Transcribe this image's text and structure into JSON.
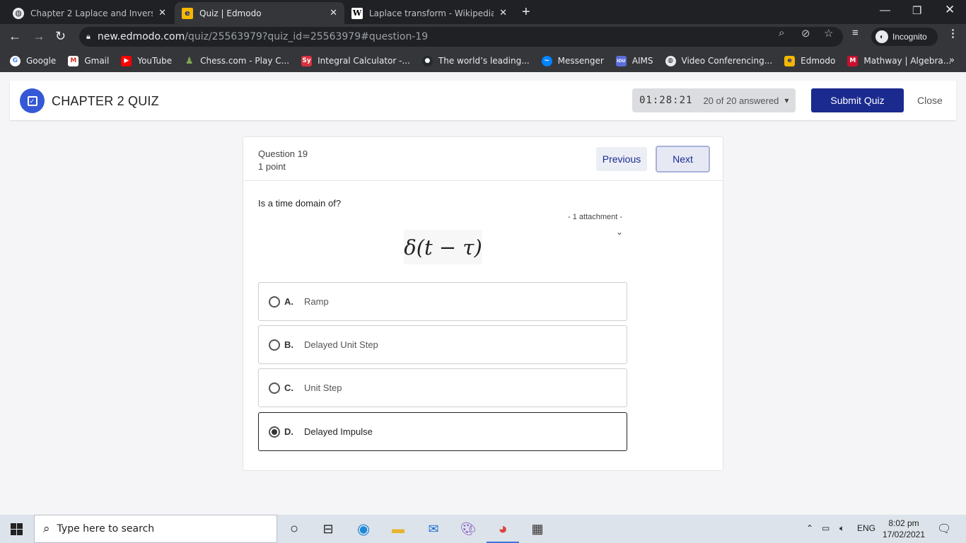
{
  "browser": {
    "tabs": [
      {
        "title": "Chapter 2 Laplace and Inverse Lap",
        "favicon": "chrome-globe-icon",
        "active": false
      },
      {
        "title": "Quiz | Edmodo",
        "favicon": "edmodo-icon",
        "active": true
      },
      {
        "title": "Laplace transform - Wikipedia",
        "favicon": "wikipedia-icon",
        "active": false
      }
    ],
    "url_host": "new.edmodo.com",
    "url_path": "/quiz/25563979?quiz_id=25563979#question-19",
    "incognito_label": "Incognito",
    "bookmarks": [
      {
        "label": "Google",
        "icon": "google-icon",
        "color": "#ea4335"
      },
      {
        "label": "Gmail",
        "icon": "gmail-icon",
        "color": "#d93025"
      },
      {
        "label": "YouTube",
        "icon": "youtube-icon",
        "color": "#ff0000"
      },
      {
        "label": "Chess.com - Play C...",
        "icon": "chess-icon",
        "color": "#7fa650"
      },
      {
        "label": "Integral Calculator -...",
        "icon": "symbolab-icon",
        "color": "#d5323c"
      },
      {
        "label": "The world’s leading...",
        "icon": "github-icon",
        "color": "#24292e"
      },
      {
        "label": "Messenger",
        "icon": "messenger-icon",
        "color": "#0084ff"
      },
      {
        "label": "AIMS",
        "icon": "aims-icon",
        "color": "#5b6ed8"
      },
      {
        "label": "Video Conferencing...",
        "icon": "globe-icon",
        "color": "#5f6368"
      },
      {
        "label": "Edmodo",
        "icon": "edmodo-icon",
        "color": "#f5b800"
      },
      {
        "label": "Mathway | Algebra...",
        "icon": "mathway-icon",
        "color": "#c8102e"
      }
    ],
    "bookmarks_more": "»"
  },
  "quiz": {
    "title": "CHAPTER 2 QUIZ",
    "timer": "01:28:21",
    "answered": "20 of 20 answered",
    "submit_label": "Submit Quiz",
    "close_label": "Close"
  },
  "question": {
    "number_label": "Question 19",
    "points_label": "1 point",
    "previous_label": "Previous",
    "next_label": "Next",
    "text": "Is a time domain of?",
    "attachment_label": "- 1 attachment  -",
    "formula": "δ(t − τ)",
    "options": [
      {
        "letter": "A.",
        "text": "Ramp",
        "selected": false
      },
      {
        "letter": "B.",
        "text": "Delayed Unit Step",
        "selected": false
      },
      {
        "letter": "C.",
        "text": "Unit Step",
        "selected": false
      },
      {
        "letter": "D.",
        "text": "Delayed Impulse",
        "selected": true
      }
    ]
  },
  "taskbar": {
    "search_placeholder": "Type here to search",
    "language": "ENG",
    "time": "8:02 pm",
    "date": "17/02/2021"
  },
  "colors": {
    "accent_blue": "#1b2a8f",
    "logo_blue": "#3559d6"
  }
}
